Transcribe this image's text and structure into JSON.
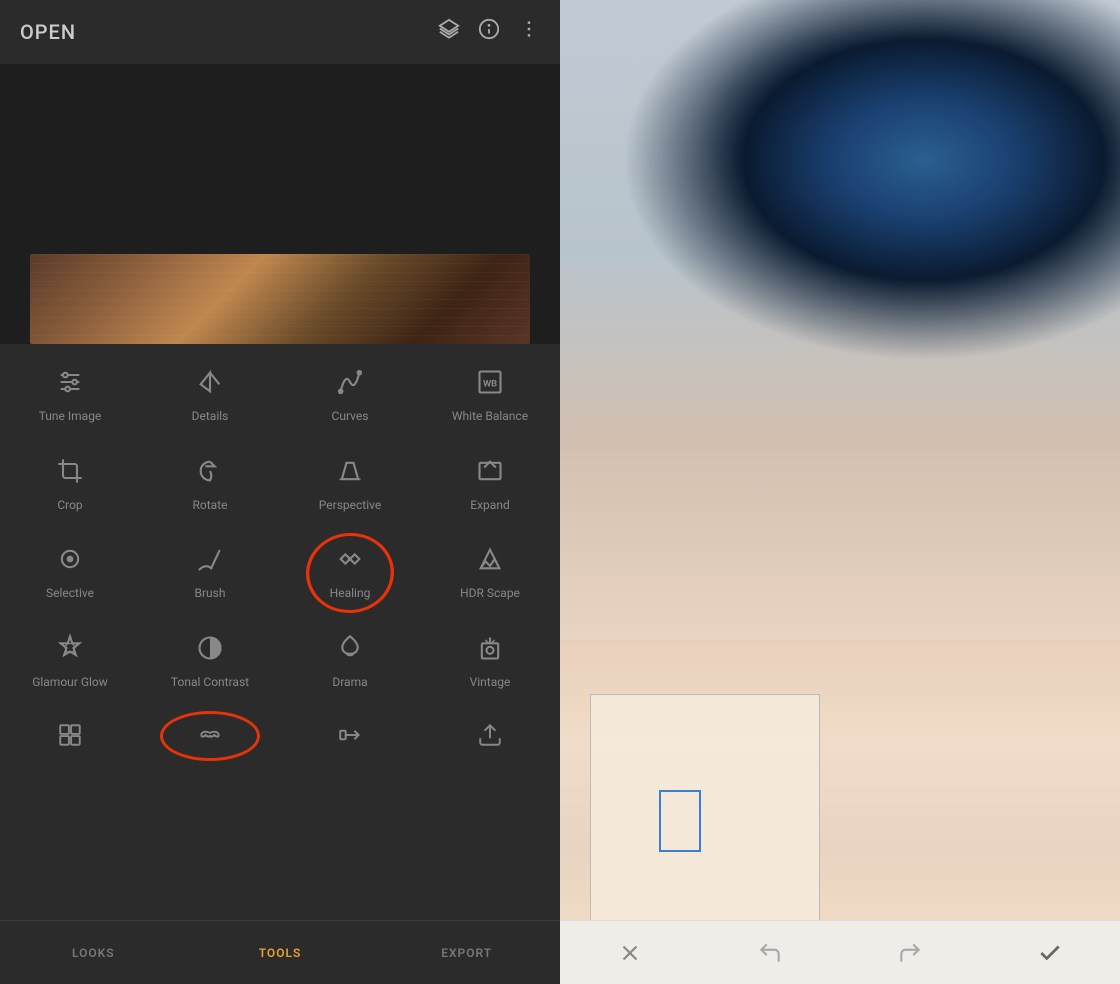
{
  "app": {
    "title": "OPEN"
  },
  "topIcons": [
    "layers-icon",
    "info-icon",
    "more-icon"
  ],
  "tools": [
    {
      "id": "tune-image",
      "label": "Tune Image",
      "icon": "sliders"
    },
    {
      "id": "details",
      "label": "Details",
      "icon": "triangle-down"
    },
    {
      "id": "curves",
      "label": "Curves",
      "icon": "curves"
    },
    {
      "id": "white-balance",
      "label": "White\nBalance",
      "icon": "wb"
    },
    {
      "id": "crop",
      "label": "Crop",
      "icon": "crop"
    },
    {
      "id": "rotate",
      "label": "Rotate",
      "icon": "rotate"
    },
    {
      "id": "perspective",
      "label": "Perspective",
      "icon": "perspective"
    },
    {
      "id": "expand",
      "label": "Expand",
      "icon": "expand"
    },
    {
      "id": "selective",
      "label": "Selective",
      "icon": "selective"
    },
    {
      "id": "brush",
      "label": "Brush",
      "icon": "brush"
    },
    {
      "id": "healing",
      "label": "Healing",
      "icon": "healing"
    },
    {
      "id": "hdr-scape",
      "label": "HDR Scape",
      "icon": "hdr"
    },
    {
      "id": "glamour-glow",
      "label": "Glamour\nGlow",
      "icon": "glamour"
    },
    {
      "id": "tonal-contrast",
      "label": "Tonal\nContrast",
      "icon": "tonal"
    },
    {
      "id": "drama",
      "label": "Drama",
      "icon": "drama"
    },
    {
      "id": "vintage",
      "label": "Vintage",
      "icon": "vintage"
    }
  ],
  "bottomNav": [
    {
      "id": "looks",
      "label": "LOOKS",
      "active": false
    },
    {
      "id": "tools",
      "label": "TOOLS",
      "active": true
    },
    {
      "id": "export",
      "label": "EXPORT",
      "active": false
    }
  ],
  "actionBar": {
    "cancel": "✕",
    "undo": "↺",
    "redo": "↻",
    "confirm": "✓"
  }
}
